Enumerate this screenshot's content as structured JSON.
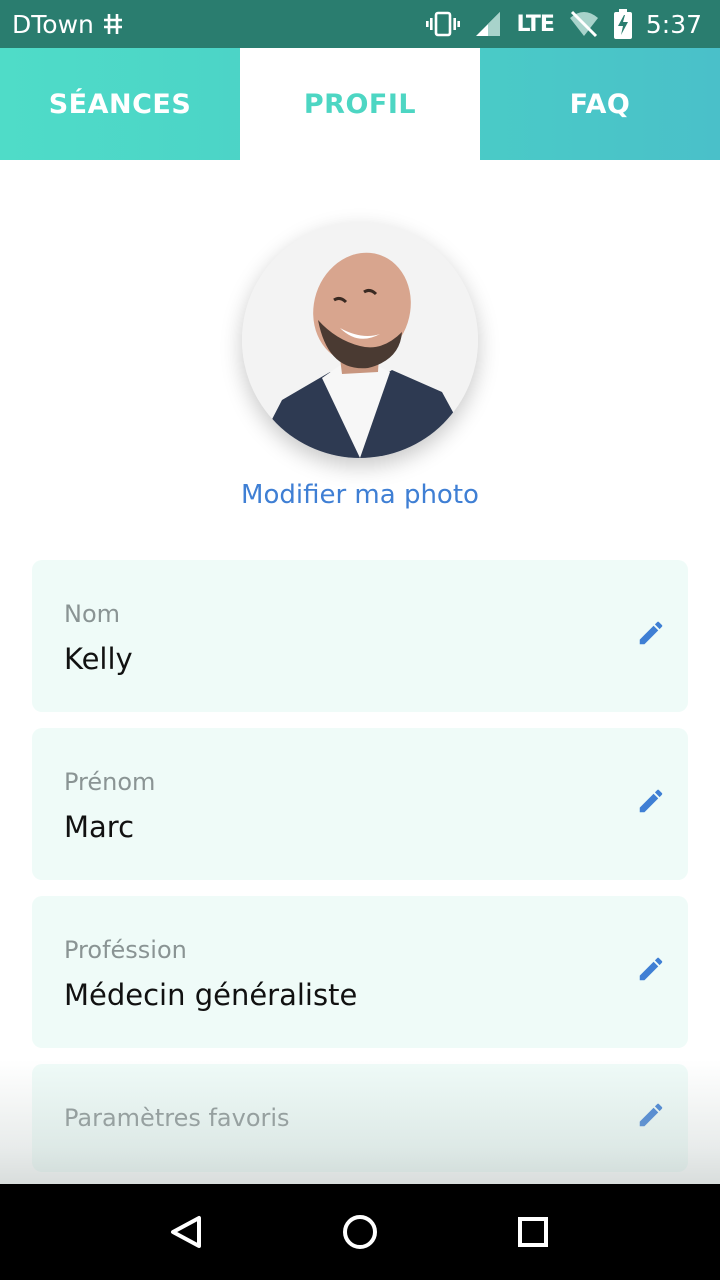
{
  "status_bar": {
    "carrier": "DTown",
    "network": "LTE",
    "time": "5:37"
  },
  "tabs": [
    {
      "label": "SÉANCES",
      "active": false
    },
    {
      "label": "PROFIL",
      "active": true
    },
    {
      "label": "FAQ",
      "active": false
    }
  ],
  "profile": {
    "modify_photo_label": "Modifier ma photo",
    "fields": [
      {
        "label": "Nom",
        "value": "Kelly"
      },
      {
        "label": "Prénom",
        "value": "Marc"
      },
      {
        "label": "Proféssion",
        "value": "Médecin généraliste"
      },
      {
        "label": "Paramètres favoris",
        "value": ""
      }
    ]
  },
  "colors": {
    "accent": "#4dd6c3",
    "status_bar": "#2a7d6f",
    "link": "#3f7fd4",
    "card_bg": "#effbf8"
  },
  "icons": {
    "edit": "pencil-icon",
    "nav_back": "back-triangle-icon",
    "nav_home": "home-circle-icon",
    "nav_recents": "recents-square-icon"
  }
}
